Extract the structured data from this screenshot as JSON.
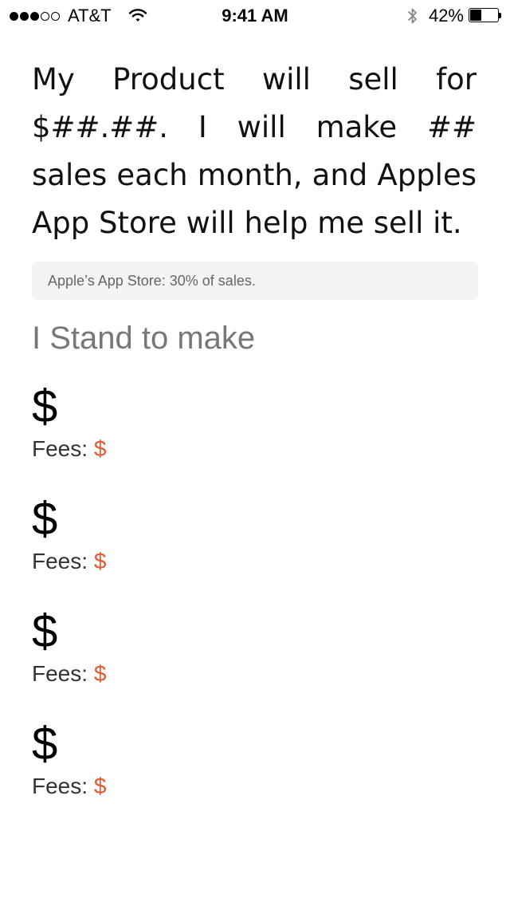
{
  "status_bar": {
    "signal_bars_filled": 3,
    "signal_bars_total": 5,
    "carrier": "AT&T",
    "time": "9:41 AM",
    "battery_percent_text": "42%",
    "battery_level": 0.42
  },
  "intro": {
    "text": "My Product will sell for $##.##. I will make ## sales each month, and Apples App Store will help me sell it."
  },
  "note": {
    "text": "Apple’s App Store: 30%  of sales."
  },
  "heading": {
    "text": "I Stand to make"
  },
  "earnings": [
    {
      "amount": "$",
      "fees_label": "Fees: ",
      "fees_value": "$"
    },
    {
      "amount": "$",
      "fees_label": "Fees: ",
      "fees_value": "$"
    },
    {
      "amount": "$",
      "fees_label": "Fees: ",
      "fees_value": "$"
    },
    {
      "amount": "$",
      "fees_label": "Fees: ",
      "fees_value": "$"
    }
  ],
  "colors": {
    "accent": "#e8552f",
    "heading_gray": "#777777",
    "note_background": "#f4f4f4"
  },
  "icons": {
    "wifi": "wifi-icon",
    "bluetooth": "bluetooth-icon",
    "battery": "battery-icon"
  }
}
